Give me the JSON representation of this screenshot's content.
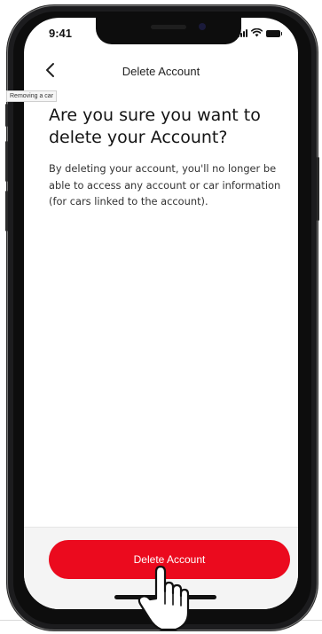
{
  "status_bar": {
    "time": "9:41"
  },
  "nav": {
    "title": "Delete Account"
  },
  "tooltip": {
    "text": "Removing a car"
  },
  "content": {
    "heading": "Are you sure you want to delete your Account?",
    "body": "By deleting your account, you'll no longer be able to access any account or car information (for cars linked to the account)."
  },
  "actions": {
    "delete_label": "Delete Account"
  },
  "colors": {
    "accent": "#eb0a1e",
    "footer_bg": "#f4f4f4",
    "text_primary": "#141414"
  },
  "icons": {
    "back": "chevron-left-icon",
    "signal": "cellular-signal-icon",
    "wifi": "wifi-icon",
    "battery": "battery-icon",
    "cursor": "hand-pointer-icon"
  }
}
